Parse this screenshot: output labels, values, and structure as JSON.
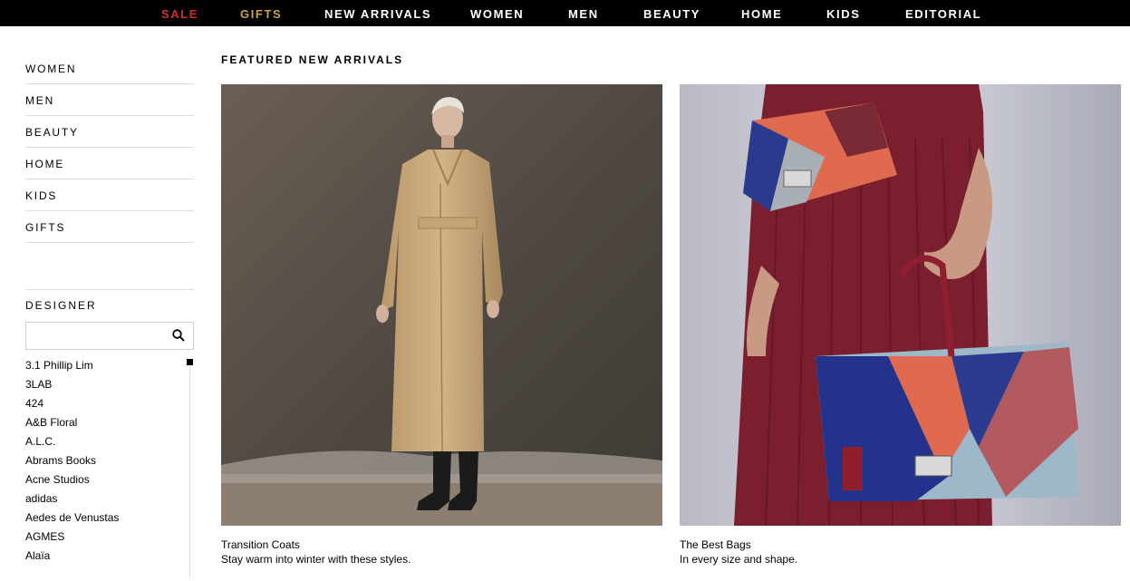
{
  "topnav": {
    "items": [
      {
        "label": "SALE",
        "color": "#d0302d"
      },
      {
        "label": "GIFTS",
        "color": "#c9a34a"
      },
      {
        "label": "NEW ARRIVALS",
        "color": "#ffffff"
      },
      {
        "label": "WOMEN",
        "color": "#ffffff"
      },
      {
        "label": "MEN",
        "color": "#ffffff"
      },
      {
        "label": "BEAUTY",
        "color": "#ffffff"
      },
      {
        "label": "HOME",
        "color": "#ffffff"
      },
      {
        "label": "KIDS",
        "color": "#ffffff"
      },
      {
        "label": "EDITORIAL",
        "color": "#ffffff"
      }
    ]
  },
  "sidebar": {
    "categories": [
      "WOMEN",
      "MEN",
      "BEAUTY",
      "HOME",
      "KIDS",
      "GIFTS"
    ],
    "designer_heading": "DESIGNER",
    "search_value": "",
    "search_icon": "search-icon",
    "designers": [
      "3.1 Phillip Lim",
      "3LAB",
      "424",
      "A&B Floral",
      "A.L.C.",
      "Abrams Books",
      "Acne Studios",
      "adidas",
      "Aedes de Venustas",
      "AGMES",
      "Alaïa"
    ]
  },
  "main": {
    "section_title": "FEATURED NEW ARRIVALS",
    "cards": [
      {
        "title": "Transition Coats",
        "subtitle": "Stay warm into winter with these styles."
      },
      {
        "title": "The Best Bags",
        "subtitle": "In every size and shape."
      }
    ]
  }
}
